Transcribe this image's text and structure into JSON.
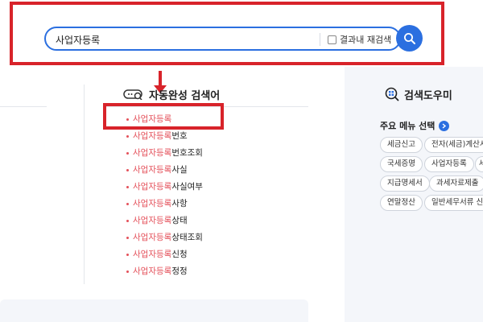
{
  "search": {
    "query": "사업자등록",
    "recheck_label": "결과내 재검색"
  },
  "autocomplete": {
    "title": "자동완성 검색어",
    "items": [
      {
        "match": "사업자등록",
        "rest": ""
      },
      {
        "match": "사업자등록",
        "rest": "번호"
      },
      {
        "match": "사업자등록",
        "rest": "번호조회"
      },
      {
        "match": "사업자등록",
        "rest": "사실"
      },
      {
        "match": "사업자등록",
        "rest": "사실여부"
      },
      {
        "match": "사업자등록",
        "rest": "사항"
      },
      {
        "match": "사업자등록",
        "rest": "상태"
      },
      {
        "match": "사업자등록",
        "rest": "상태조회"
      },
      {
        "match": "사업자등록",
        "rest": "신청"
      },
      {
        "match": "사업자등록",
        "rest": "정정"
      }
    ]
  },
  "help": {
    "title": "검색도우미",
    "menu_title": "주요 메뉴 선택",
    "chips": [
      [
        "세금신고",
        "전자(세금)계산서"
      ],
      [
        "국세증명",
        "사업자등록",
        "세"
      ],
      [
        "지급명세서",
        "과세자료제출"
      ],
      [
        "연말정산",
        "일반세무서류 신청"
      ]
    ]
  },
  "colors": {
    "accent": "#2b6fe0",
    "highlight": "#e4505a",
    "annotation_red": "#d8232a"
  }
}
